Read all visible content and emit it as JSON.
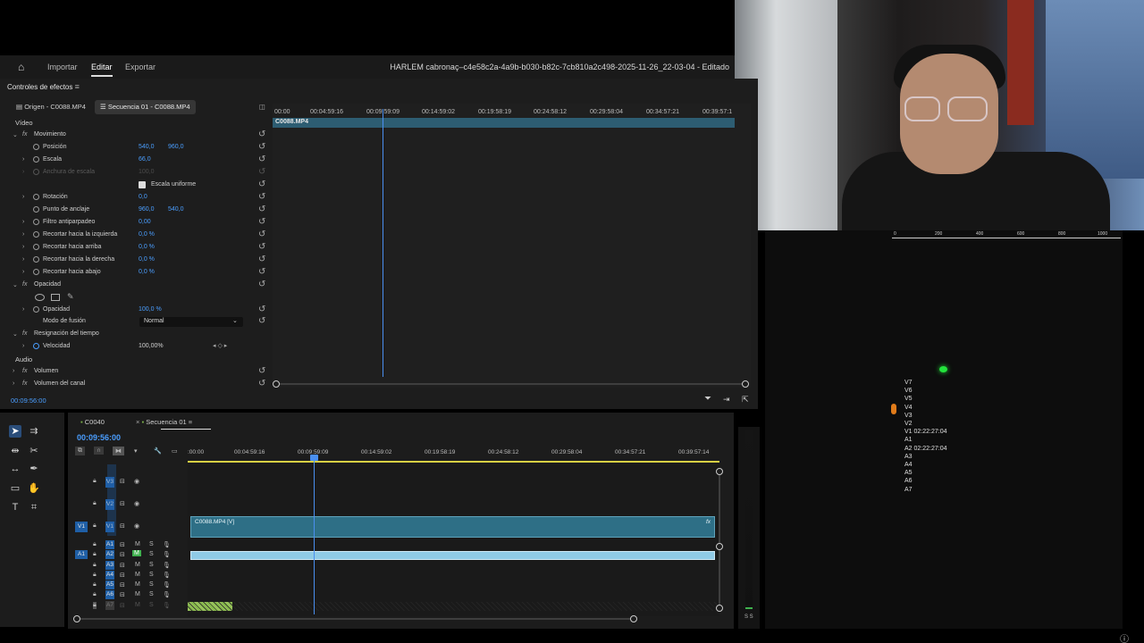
{
  "menubar": {
    "items": [
      "Importar",
      "Editar",
      "Exportar"
    ],
    "document_title": "HARLEM cabronaç–c4e58c2a-4a9b-b030-b82c-7cb810a2c498-2025-11-26_22-03-04 - Editado"
  },
  "effects": {
    "panel_title": "Controles de efectos",
    "tabs": [
      "Origen - C0088.MP4",
      "Secuencia 01 - C0088.MP4"
    ],
    "section_video": "Vídeo",
    "section_audio": "Audio",
    "fx_movimiento": "Movimiento",
    "props": {
      "posicion": {
        "label": "Posición",
        "v1": "540,0",
        "v2": "960,0"
      },
      "escala": {
        "label": "Escala",
        "v1": "66,0"
      },
      "anchura": {
        "label": "Anchura de escala",
        "v1": "100,0"
      },
      "escala_uniforme": "Escala uniforme",
      "rotacion": {
        "label": "Rotación",
        "v1": "0,0"
      },
      "anclaje": {
        "label": "Punto de anclaje",
        "v1": "960,0",
        "v2": "540,0"
      },
      "antiparpadeo": {
        "label": "Filtro antiparpadeo",
        "v1": "0,00"
      },
      "rec_izq": {
        "label": "Recortar hacia la izquierda",
        "v1": "0,0 %"
      },
      "rec_arr": {
        "label": "Recortar hacia arriba",
        "v1": "0,0 %"
      },
      "rec_der": {
        "label": "Recortar hacia la derecha",
        "v1": "0,0 %"
      },
      "rec_aba": {
        "label": "Recortar hacia abajo",
        "v1": "0,0 %"
      }
    },
    "fx_opacidad": "Opacidad",
    "opacidad": {
      "label": "Opacidad",
      "v1": "100,0 %"
    },
    "modo_fusion": {
      "label": "Modo de fusión",
      "value": "Normal"
    },
    "fx_resignacion": "Resignación del tiempo",
    "velocidad": {
      "label": "Velocidad",
      "v1": "100,00%"
    },
    "fx_volumen": "Volumen",
    "fx_volumen_canal": "Volumen del canal",
    "timecode": "00:09:56:00",
    "ruler": [
      "00:00",
      "00:04:59:16",
      "00:09:59:09",
      "00:14:59:02",
      "00:19:58:19",
      "00:24:58:12",
      "00:29:58:04",
      "00:34:57:21",
      "00:39:57:1"
    ],
    "clip_name": "C0088.MP4"
  },
  "timeline": {
    "tabs": [
      "C0040",
      "Secuencia 01"
    ],
    "timecode": "00:09:56:00",
    "ruler": [
      ":00:00",
      "00:04:59:16",
      "00:09:59:09",
      "00:14:59:02",
      "00:19:58:19",
      "00:24:58:12",
      "00:29:58:04",
      "00:34:57:21",
      "00:39:57:14"
    ],
    "video_tracks": [
      "V3",
      "V2",
      "V1"
    ],
    "audio_tracks": [
      "A1",
      "A2",
      "A3",
      "A4",
      "A5",
      "A6",
      "A7"
    ],
    "src_video": "V1",
    "src_audio": "A1",
    "video_clip": "C0088.MP4 [V]",
    "m_label": "M",
    "s_label": "S"
  },
  "program": {
    "ruler": [
      "0",
      "200",
      "400",
      "600",
      "800",
      "1000"
    ],
    "labels": [
      "V7",
      "V6",
      "V5",
      "V4",
      "V3",
      "V2",
      "V1 02:22:27:04",
      "A1",
      "A2 02:22:27:04",
      "A3",
      "A4",
      "A5",
      "A6",
      "A7"
    ]
  },
  "meter": {
    "label": "S S"
  },
  "colors": {
    "accent": "#4a9eff",
    "clip_video": "#2e6f86",
    "clip_audio": "#8fcbe6",
    "clip_green": "#98c45a"
  }
}
